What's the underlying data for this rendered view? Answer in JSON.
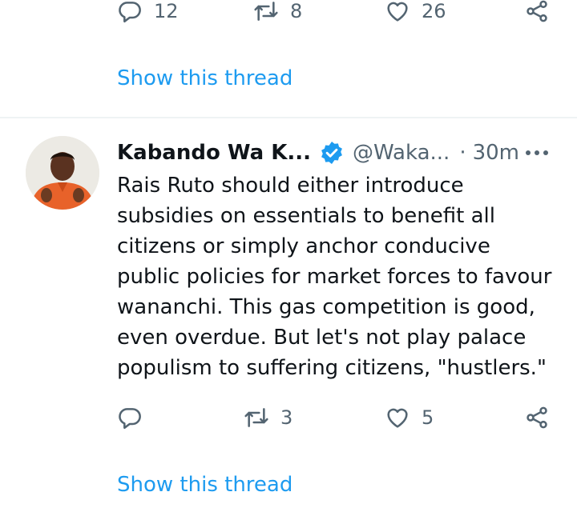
{
  "prev_tweet": {
    "actions": {
      "replies": "12",
      "retweets": "8",
      "likes": "26"
    },
    "show_thread": "Show this thread"
  },
  "tweet": {
    "author": "Kabando Wa K...",
    "handle": "@Waka...",
    "separator": "·",
    "time": "30m",
    "text": "Rais Ruto should either introduce\nsubsidies on essentials to benefit all\ncitizens or simply anchor conducive\npublic policies for market forces to favour\nwananchi. This gas competition is good,\neven overdue. But let's not play palace\npopulism to suffering citizens, \"hustlers.\"",
    "actions": {
      "replies": "",
      "retweets": "3",
      "likes": "5"
    },
    "show_thread": "Show this thread",
    "verified": true
  },
  "colors": {
    "link": "#1d9bf0",
    "secondary_text": "#536471",
    "verified_badge": "#1d9bf0",
    "divider": "#eff3f4"
  },
  "icons": [
    "reply-icon",
    "retweet-icon",
    "like-icon",
    "share-icon",
    "verified-badge-icon",
    "more-options-icon"
  ]
}
